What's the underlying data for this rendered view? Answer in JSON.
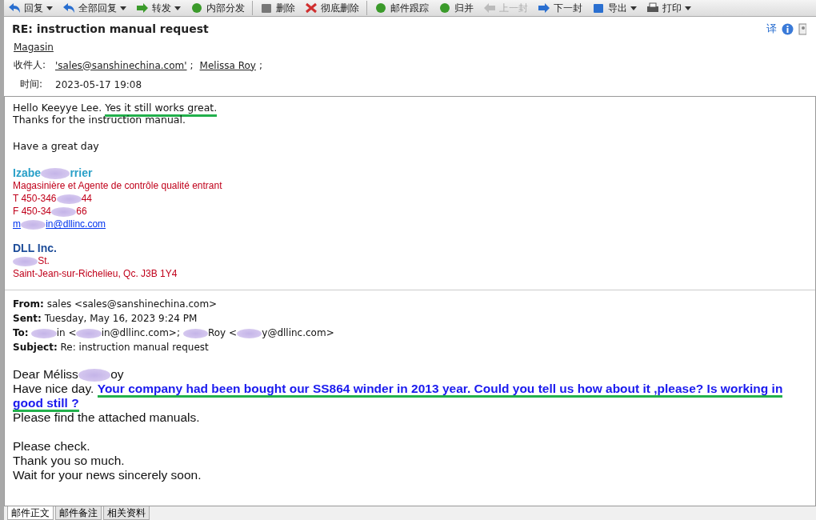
{
  "toolbar": [
    {
      "kind": "reply",
      "label": "回复",
      "dropdown": true,
      "disabled": false
    },
    {
      "kind": "reply-all",
      "label": "全部回复",
      "dropdown": true,
      "disabled": false
    },
    {
      "kind": "forward",
      "label": "转发",
      "dropdown": true,
      "disabled": false
    },
    {
      "kind": "distribute",
      "label": "内部分发",
      "dropdown": false,
      "disabled": false
    },
    {
      "kind": "delete",
      "label": "删除",
      "dropdown": false,
      "disabled": false
    },
    {
      "kind": "purge",
      "label": "彻底删除",
      "dropdown": false,
      "disabled": false
    },
    {
      "kind": "track",
      "label": "邮件跟踪",
      "dropdown": false,
      "disabled": false
    },
    {
      "kind": "merge",
      "label": "归并",
      "dropdown": false,
      "disabled": false
    },
    {
      "kind": "prev",
      "label": "上一封",
      "dropdown": false,
      "disabled": true
    },
    {
      "kind": "next",
      "label": "下一封",
      "dropdown": false,
      "disabled": false
    },
    {
      "kind": "export",
      "label": "导出",
      "dropdown": true,
      "disabled": false
    },
    {
      "kind": "print",
      "label": "打印",
      "dropdown": true,
      "disabled": false
    }
  ],
  "message": {
    "subject": "RE: instruction manual request",
    "sender": "Magasin",
    "recipients_label": "收件人:",
    "recipients": [
      "'sales@sanshinechina.com'",
      "Melissa Roy"
    ],
    "recipient_separator": ";",
    "time_label": "时间:",
    "time": "2023-05-17 19:08",
    "translate": "译"
  },
  "reply": {
    "first_line": [
      {
        "kind": "text",
        "text": "Hello Keeyye Lee. ",
        "marked": false
      },
      {
        "kind": "text",
        "text": "Yes it still works great.",
        "marked": true
      }
    ],
    "thanks": "Thanks for the instruction manual.",
    "closing": "Have a great day"
  },
  "signature": {
    "name": [
      {
        "kind": "text",
        "text": "Izabe"
      },
      {
        "kind": "smudge"
      },
      {
        "kind": "text",
        "text": "rrier"
      }
    ],
    "title": "Magasinière et Agente de contrôle qualité entrant",
    "phone": [
      {
        "kind": "text",
        "text": "T 450-346"
      },
      {
        "kind": "smudge"
      },
      {
        "kind": "text",
        "text": "44"
      }
    ],
    "fax": [
      {
        "kind": "text",
        "text": "F 450-34"
      },
      {
        "kind": "smudge"
      },
      {
        "kind": "text",
        "text": "66"
      }
    ],
    "email": [
      {
        "kind": "text",
        "text": "m"
      },
      {
        "kind": "smudge"
      },
      {
        "kind": "text",
        "text": "in@dllinc.com"
      }
    ],
    "company": "DLL Inc.",
    "address": [
      {
        "kind": "smudge"
      },
      {
        "kind": "text",
        "text": "St."
      }
    ],
    "city": "Saint-Jean-sur-Richelieu, Qc. J3B 1Y4"
  },
  "quoted_header": [
    {
      "label": "From:",
      "parts": [
        {
          "kind": "text",
          "text": "sales <sales@sanshinechina.com>"
        }
      ]
    },
    {
      "label": "Sent:",
      "parts": [
        {
          "kind": "text",
          "text": "Tuesday, May 16, 2023 9:24 PM"
        }
      ]
    },
    {
      "label": "To:",
      "parts": [
        {
          "kind": "smudge"
        },
        {
          "kind": "text",
          "text": "in <"
        },
        {
          "kind": "smudge"
        },
        {
          "kind": "text",
          "text": "in@dllinc.com>; "
        },
        {
          "kind": "smudge"
        },
        {
          "kind": "text",
          "text": "Roy <"
        },
        {
          "kind": "smudge"
        },
        {
          "kind": "text",
          "text": "y@dllinc.com>"
        }
      ]
    },
    {
      "label": "Subject:",
      "parts": [
        {
          "kind": "text",
          "text": "Re: instruction manual request"
        }
      ]
    }
  ],
  "quoted_body": {
    "greeting": [
      {
        "kind": "text",
        "text": "Dear Méliss"
      },
      {
        "kind": "smudge"
      },
      {
        "kind": "text",
        "text": "oy"
      }
    ],
    "paragraph": "Have nice day. **Your company had been bought our SS864 winder in 2013 year. Could you tell us how about it ,please? Is working in good still ?**",
    "question_marked": true,
    "attached": "Please find the attached manuals.",
    "lines": [
      "Please check.",
      "Thank you so much.",
      "Wait for your news sincerely soon."
    ]
  },
  "tabs": [
    {
      "label": "邮件正文",
      "selected": true
    },
    {
      "label": "邮件备注",
      "selected": false
    },
    {
      "label": "相关资料",
      "selected": false
    }
  ]
}
